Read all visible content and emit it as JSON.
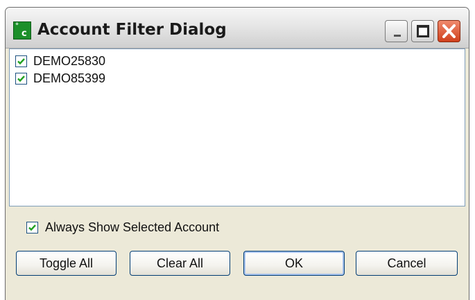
{
  "window": {
    "title": "Account Filter Dialog",
    "icon": "app-logo-icon",
    "icon_glyphs": [
      "°",
      "c"
    ],
    "controls": [
      "minimize-icon",
      "maximize-icon",
      "close-icon"
    ]
  },
  "accounts": [
    {
      "label": "DEMO25830",
      "checked": true
    },
    {
      "label": "DEMO85399",
      "checked": true
    }
  ],
  "options": {
    "always_show_label": "Always Show Selected Account",
    "always_show_checked": true
  },
  "buttons": {
    "toggle_all": "Toggle All",
    "clear_all": "Clear All",
    "ok": "OK",
    "cancel": "Cancel"
  },
  "colors": {
    "accent_checkmark": "#21a121",
    "close_button": "#d9532c",
    "app_icon": "#1c8f2a"
  }
}
